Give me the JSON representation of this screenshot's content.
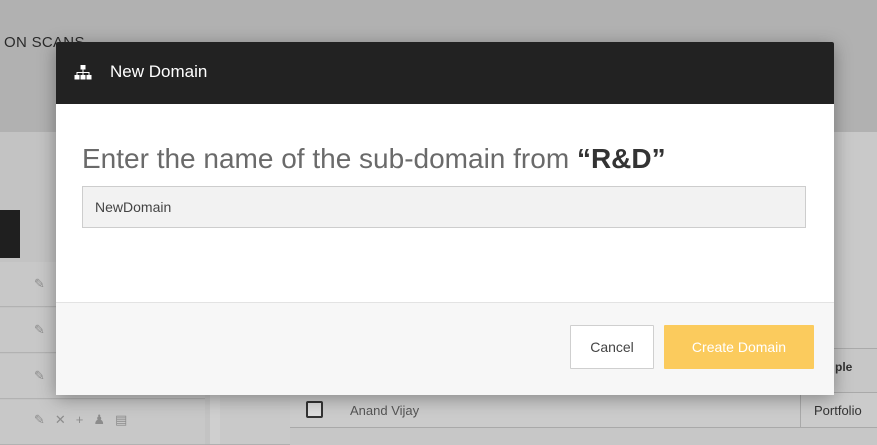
{
  "background": {
    "heading": "ON SCANS",
    "table": {
      "column_header": "ple",
      "row": {
        "name": "Anand Vijay",
        "role": "Portfolio"
      }
    }
  },
  "modal": {
    "title": "New Domain",
    "icon": "sitemap-icon",
    "prompt_text": "Enter the name of the sub-domain from",
    "parent_domain": "“R&D”",
    "input": {
      "value": "NewDomain",
      "placeholder": ""
    },
    "cancel_label": "Cancel",
    "create_label": "Create Domain"
  },
  "colors": {
    "header_bg": "#222222",
    "primary_button": "#fbcb5d",
    "overlay": "#b0b0b0"
  }
}
